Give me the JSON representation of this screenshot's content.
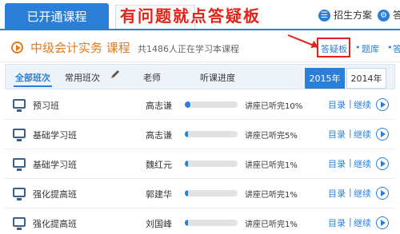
{
  "top": {
    "active_tab": "已开通课程",
    "second_tab": "有问题就点答疑板",
    "overlay": "有问题就点答疑板",
    "plan_label": "招生方案",
    "extra_label": "答"
  },
  "course": {
    "title": "中级会计实务 课程",
    "learners": "共1486人正在学习本课程",
    "links": [
      "答疑板",
      "题库",
      "答"
    ]
  },
  "table": {
    "tab_all": "全部班次",
    "tab_common": "常用班次",
    "col_teacher": "老师",
    "col_progress": "听课进度",
    "year_active": "2015年",
    "year_other": "2014年",
    "rows": [
      {
        "name": "预习班",
        "teacher": "高志谦",
        "progress_text": "讲座已听完10%",
        "progress": 0.1,
        "catalog": "目录",
        "sep": "|",
        "continue": "继续"
      },
      {
        "name": "基础学习班",
        "teacher": "高志谦",
        "progress_text": "讲座已听完5%",
        "progress": 0.05,
        "catalog": "目录",
        "sep": "|",
        "continue": "继续"
      },
      {
        "name": "基础学习班",
        "teacher": "魏红元",
        "progress_text": "讲座已听完1%",
        "progress": 0.02,
        "catalog": "目录",
        "sep": "|",
        "continue": "继续"
      },
      {
        "name": "强化提高班",
        "teacher": "郭建华",
        "progress_text": "讲座已听完1%",
        "progress": 0.02,
        "catalog": "目录",
        "sep": "|",
        "continue": "继续"
      },
      {
        "name": "强化提高班",
        "teacher": "刘国峰",
        "progress_text": "讲座已听完1%",
        "progress": 0.02,
        "catalog": "目录",
        "sep": "|",
        "continue": "继续"
      }
    ]
  },
  "colors": {
    "accent": "#2b7fd8",
    "title": "#e27a1e",
    "highlight": "#e2231a"
  },
  "icons": [
    "play-circle-icon",
    "gear-icon",
    "monitor-icon",
    "pencil-icon",
    "play-button-icon"
  ]
}
